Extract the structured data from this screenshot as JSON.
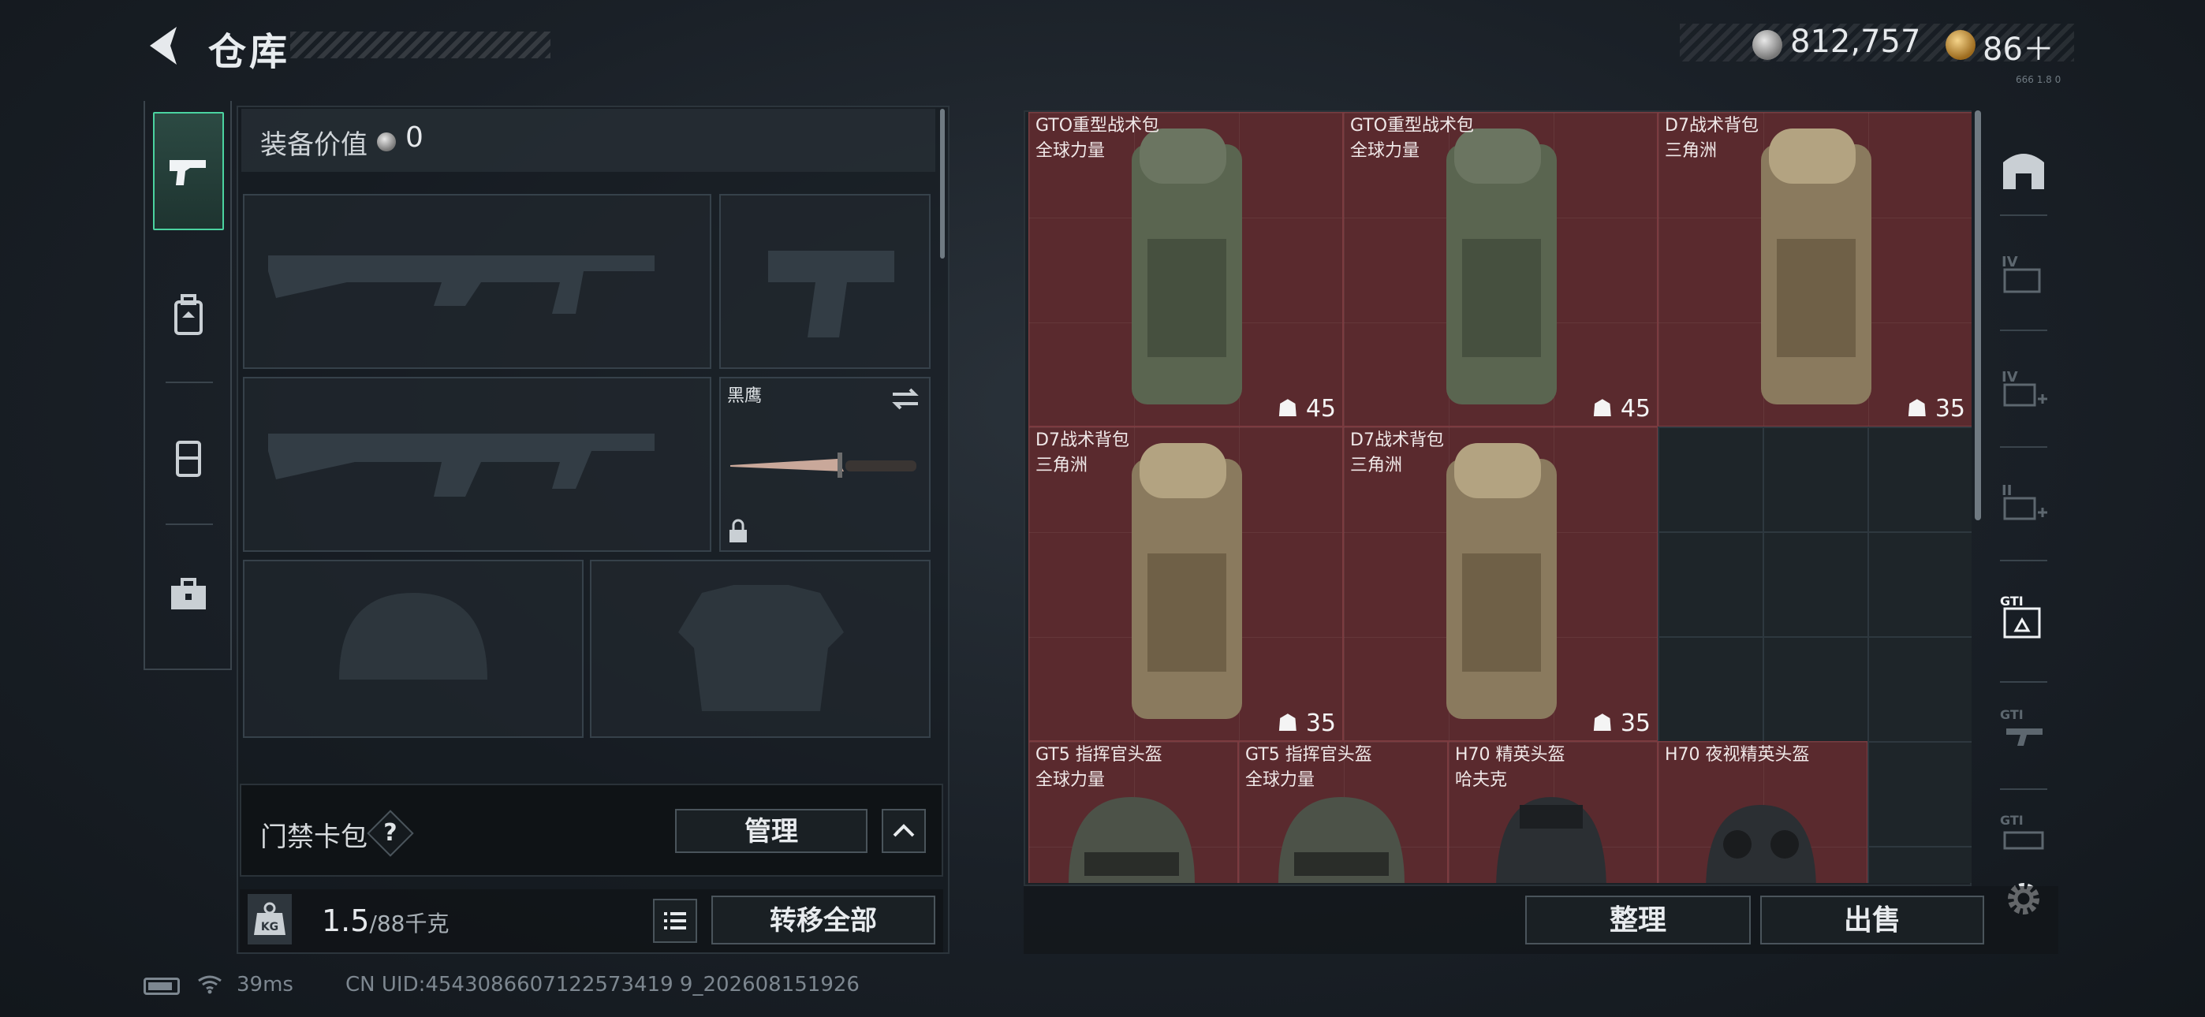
{
  "header": {
    "title": "仓库",
    "currency_silver": "812,757",
    "currency_gold": "86＋",
    "version_tag": "666 1.8 0"
  },
  "equipment": {
    "value_label": "装备价值",
    "value": "0",
    "melee_name": "黑鹰"
  },
  "access_card": {
    "label": "门禁卡包",
    "help": "?",
    "manage_label": "管理"
  },
  "weight": {
    "current": "1.5",
    "max": "/88千克",
    "kg_label": "KG",
    "transfer_label": "转移全部"
  },
  "storage": {
    "items": [
      {
        "name": "GTO重型战术包",
        "sub": "全球力量",
        "cap": "45"
      },
      {
        "name": "GTO重型战术包",
        "sub": "全球力量",
        "cap": "45"
      },
      {
        "name": "D7战术背包",
        "sub": "三角洲",
        "cap": "35"
      },
      {
        "name": "D7战术背包",
        "sub": "三角洲",
        "cap": "35"
      },
      {
        "name": "D7战术背包",
        "sub": "三角洲",
        "cap": "35"
      },
      {
        "name": "GT5 指挥官头盔",
        "sub": "全球力量"
      },
      {
        "name": "GT5 指挥官头盔",
        "sub": "全球力量"
      },
      {
        "name": "H70 精英头盔",
        "sub": "哈夫克"
      },
      {
        "name": "H70 夜视精英头盔",
        "sub": ""
      }
    ]
  },
  "actions": {
    "organize": "整理",
    "sell": "出售"
  },
  "status": {
    "ping": "39ms",
    "uid": "CN UID:4543086607122573419 9_202608151926"
  },
  "colors": {
    "accent": "#4bd3a0",
    "item_bg": "#5a2a2e"
  }
}
